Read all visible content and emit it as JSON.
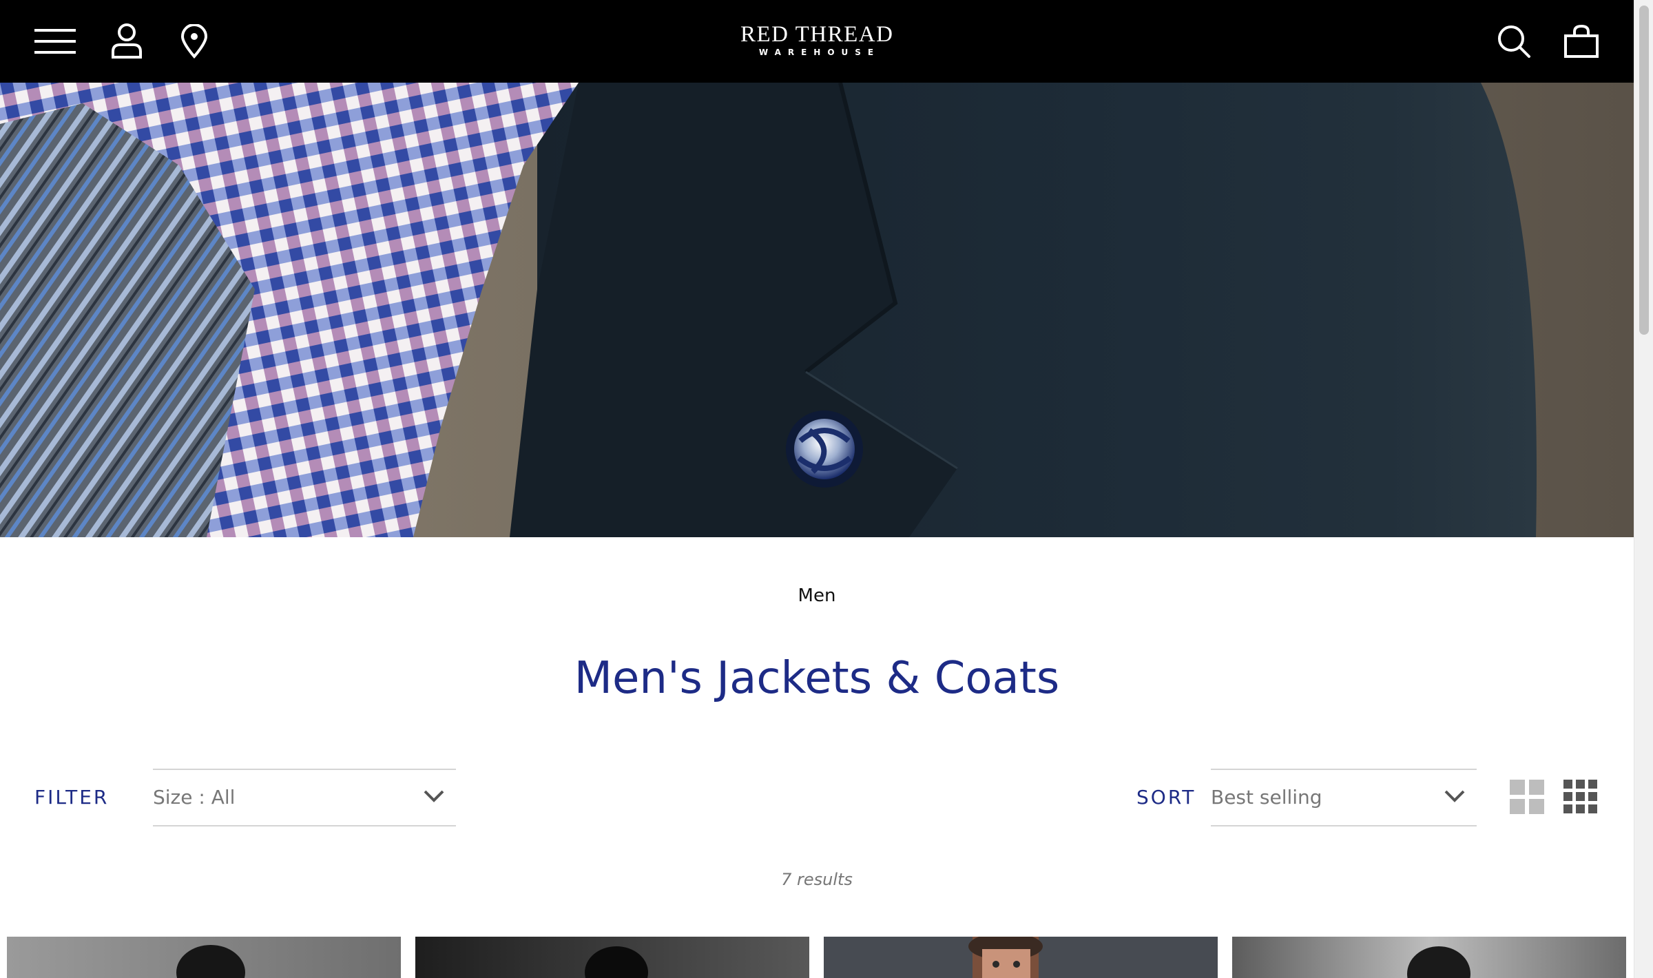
{
  "header": {
    "logo_main": "RED THREAD",
    "logo_sub": "WAREHOUSE",
    "icons": [
      "menu-icon",
      "account-icon",
      "store-location-icon",
      "search-icon",
      "cart-icon"
    ],
    "background_color": "#000000"
  },
  "breadcrumb": {
    "label": "Men"
  },
  "page": {
    "title": "Men's Jackets & Coats",
    "title_color": "#1d2b86"
  },
  "toolbar": {
    "filter_label": "FILTER",
    "size_select_value": "Size : All",
    "sort_label": "SORT",
    "sort_select_value": "Best selling",
    "view_options": [
      "two-column-grid-icon",
      "three-column-grid-icon"
    ]
  },
  "results": {
    "count_text": "7 results"
  },
  "products": [
    {
      "name": "product-1"
    },
    {
      "name": "product-2"
    },
    {
      "name": "product-3"
    },
    {
      "name": "product-4"
    }
  ]
}
